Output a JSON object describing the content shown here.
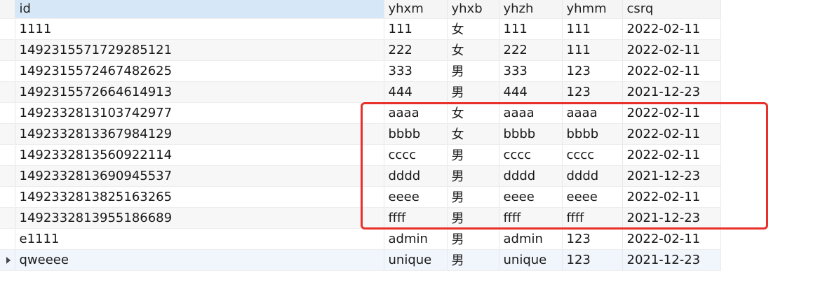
{
  "table": {
    "columns": [
      "id",
      "yhxm",
      "yhxb",
      "yhzh",
      "yhmm",
      "csrq"
    ],
    "rows": [
      [
        "1111",
        "111",
        "女",
        "111",
        "111",
        "2022-02-11"
      ],
      [
        "1492315571729285121",
        "222",
        "女",
        "222",
        "111",
        "2022-02-11"
      ],
      [
        "1492315572467482625",
        "333",
        "男",
        "333",
        "123",
        "2022-02-11"
      ],
      [
        "1492315572664614913",
        "444",
        "男",
        "444",
        "123",
        "2021-12-23"
      ],
      [
        "1492332813103742977",
        "aaaa",
        "女",
        "aaaa",
        "aaaa",
        "2022-02-11"
      ],
      [
        "1492332813367984129",
        "bbbb",
        "女",
        "bbbb",
        "bbbb",
        "2022-02-11"
      ],
      [
        "1492332813560922114",
        "cccc",
        "男",
        "cccc",
        "cccc",
        "2022-02-11"
      ],
      [
        "1492332813690945537",
        "dddd",
        "男",
        "dddd",
        "dddd",
        "2021-12-23"
      ],
      [
        "1492332813825163265",
        "eeee",
        "男",
        "eeee",
        "eeee",
        "2022-02-11"
      ],
      [
        "1492332813955186689",
        "ffff",
        "男",
        "ffff",
        "ffff",
        "2021-12-23"
      ],
      [
        "e1111",
        "admin",
        "男",
        "admin",
        "123",
        "2022-02-11"
      ],
      [
        "qweeee",
        "unique",
        "男",
        "unique",
        "123",
        "2021-12-23"
      ]
    ],
    "current_row_marker_icon": "row-pointer-icon"
  },
  "colors": {
    "highlight_border": "#e8302b",
    "selected_header": "#d6e8f8"
  }
}
